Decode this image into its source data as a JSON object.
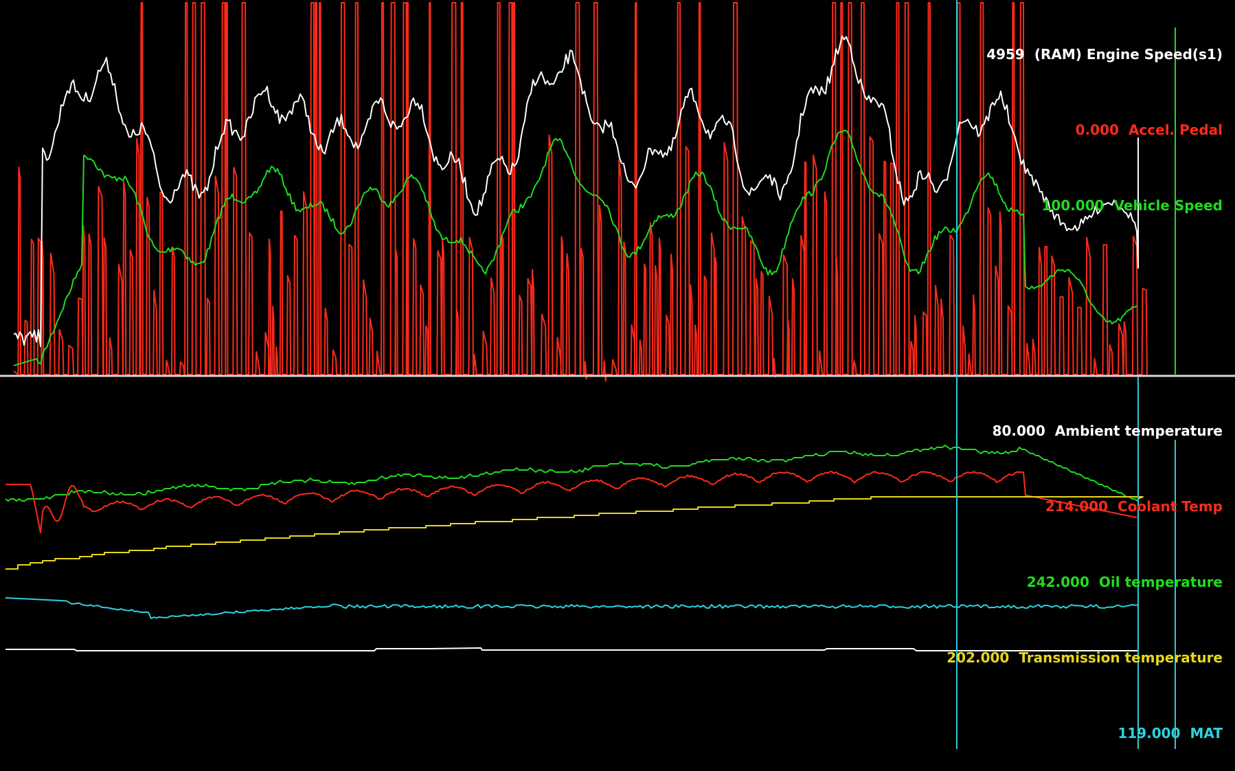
{
  "colors": {
    "background": "#000000",
    "white": "#ffffff",
    "red": "#ff2a1a",
    "green": "#1fdc1f",
    "yellow": "#e6d81c",
    "cyan": "#2ad3df",
    "divider": "#d9d9d9",
    "cursor": "#33c8d6",
    "marker": "#1fdc1f"
  },
  "top_panel": {
    "legend": [
      {
        "value": "4959",
        "name": "(RAM) Engine Speed(s1)",
        "color": "#ffffff"
      },
      {
        "value": "0.000",
        "name": "Accel. Pedal",
        "color": "#ff2a1a"
      },
      {
        "value": "100.000",
        "name": "Vehicle Speed",
        "color": "#1fdc1f"
      }
    ]
  },
  "bottom_panel": {
    "legend": [
      {
        "value": "80.000",
        "name": "Ambient temperature",
        "color": "#ffffff"
      },
      {
        "value": "214.000",
        "name": "Coolant Temp",
        "color": "#ff2a1a"
      },
      {
        "value": "242.000",
        "name": "Oil temperature",
        "color": "#1fdc1f"
      },
      {
        "value": "202.000",
        "name": "Transmission temperature",
        "color": "#e6d81c"
      },
      {
        "value": "119.000",
        "name": "MAT",
        "color": "#2ad3df"
      }
    ]
  }
}
